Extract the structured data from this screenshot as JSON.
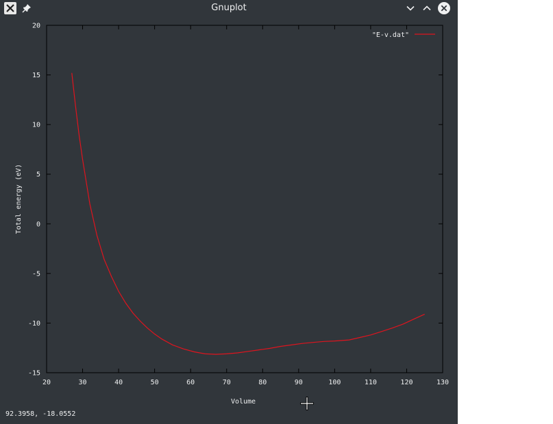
{
  "window": {
    "title": "Gnuplot"
  },
  "titlebar_buttons": {
    "app_icon": "x11-icon",
    "pin_icon": "pin-icon",
    "minimize_icon": "chevron-down-icon",
    "maximize_icon": "chevron-up-icon",
    "close_icon": "close-icon"
  },
  "status": {
    "coordinates": "92.3958, -18.0552"
  },
  "colors": {
    "window_bg": "#31363b",
    "plot_bg": "#31363b",
    "axis": "#000000",
    "series": "#e0141e",
    "text": "#eff0f1"
  },
  "chart_data": {
    "type": "line",
    "xlabel": "Volume",
    "ylabel": "Total energy (eV)",
    "xlim": [
      20,
      130
    ],
    "ylim": [
      -15,
      20
    ],
    "xticks": [
      20,
      30,
      40,
      50,
      60,
      70,
      80,
      90,
      100,
      110,
      120,
      130
    ],
    "yticks": [
      -15,
      -10,
      -5,
      0,
      5,
      10,
      15,
      20
    ],
    "grid": false,
    "legend": "top-right",
    "series": [
      {
        "name": "\"E-v.dat\"",
        "color": "#e0141e",
        "x": [
          27,
          28,
          29,
          30,
          32,
          34,
          36,
          38,
          40,
          42,
          44,
          46,
          48,
          50,
          52,
          55,
          58,
          61,
          64,
          67,
          70,
          73,
          76,
          79,
          82,
          85,
          88,
          91,
          94,
          97,
          100,
          104,
          107,
          110,
          113,
          116,
          119,
          122,
          125
        ],
        "y": [
          15.2,
          12.0,
          9.0,
          6.5,
          2.0,
          -1.2,
          -3.6,
          -5.3,
          -6.8,
          -8.0,
          -9.0,
          -9.8,
          -10.5,
          -11.1,
          -11.6,
          -12.2,
          -12.6,
          -12.9,
          -13.1,
          -13.15,
          -13.1,
          -13.0,
          -12.85,
          -12.7,
          -12.55,
          -12.35,
          -12.2,
          -12.05,
          -11.95,
          -11.85,
          -11.8,
          -11.7,
          -11.45,
          -11.2,
          -10.85,
          -10.5,
          -10.1,
          -9.6,
          -9.1
        ]
      }
    ]
  }
}
